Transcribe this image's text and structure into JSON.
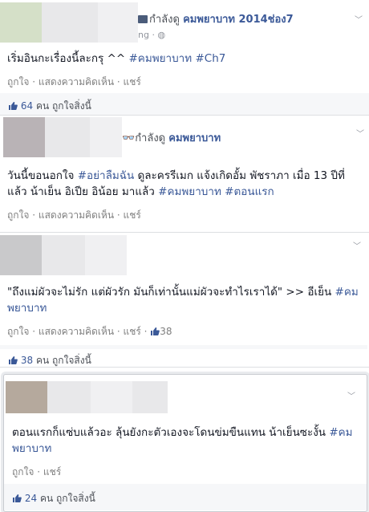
{
  "posts": [
    {
      "header_prefix": "กำลังดู",
      "header_show": "คมพยาบาท 2014ช่อง7",
      "header_sub": "ng ·",
      "text_plain": "เริ่มอินกะเรื่องนี้ละกรุ ^^ ",
      "tags": [
        "#คมพยาบาท",
        "#Ch7"
      ],
      "actions": [
        "ถูกใจ",
        "แสดงความคิดเห็น",
        "แชร์"
      ],
      "like_count": "64",
      "like_suffix": "คน ถูกใจสิ่งนี้"
    },
    {
      "header_prefix": "กำลังดู",
      "header_show": "คมพยาบาท",
      "text_a": "วันนี้ขอนอกใจ ",
      "tag_a": "#อย่าลืมฉัน",
      "text_b": " ดูละครรีเมก แจ้งเกิดอั้ม พัชราภา เมื่อ 13 ปีที่แล้ว น้าเย็น อิเปีย อิน้อย มาแล้ว ",
      "tag_b": "#คมพยาบาท",
      "tag_c": "#ตอนแรก",
      "actions": [
        "ถูกใจ",
        "แสดงความคิดเห็น",
        "แชร์"
      ]
    },
    {
      "text_plain": "\"ถึงแม่ผัวจะไม่รัก แต่ผัวรัก มันก็เท่านั้นแม่ผัวจะทำไรเราได้\" >> อีเย็น ",
      "tag": "#คมพยาบาท",
      "actions": [
        "ถูกใจ",
        "แสดงความคิดเห็น",
        "แชร์"
      ],
      "inline_likes": "38",
      "like_count": "38",
      "like_suffix": "คน ถูกใจสิ่งนี้"
    },
    {
      "text_plain": "ตอนแรกก็แซ่บแล้วอะ ลุ้นยังกะตัวเองจะโดนข่มขืนแทน น้าเย็นซะงั้น ",
      "tag": "#คมพยาบาท",
      "actions": [
        "ถูกใจ",
        "แชร์"
      ],
      "like_count": "24",
      "like_suffix": "คน ถูกใจสิ่งนี้"
    }
  ],
  "icons": {
    "tv": "tv-icon",
    "glasses": "glasses-icon",
    "globe": "globe-icon",
    "thumb": "thumbs-up-icon",
    "chevron": "chevron-down-icon"
  },
  "colors": {
    "link": "#3b5998",
    "text": "#141823",
    "muted": "#90949c"
  }
}
